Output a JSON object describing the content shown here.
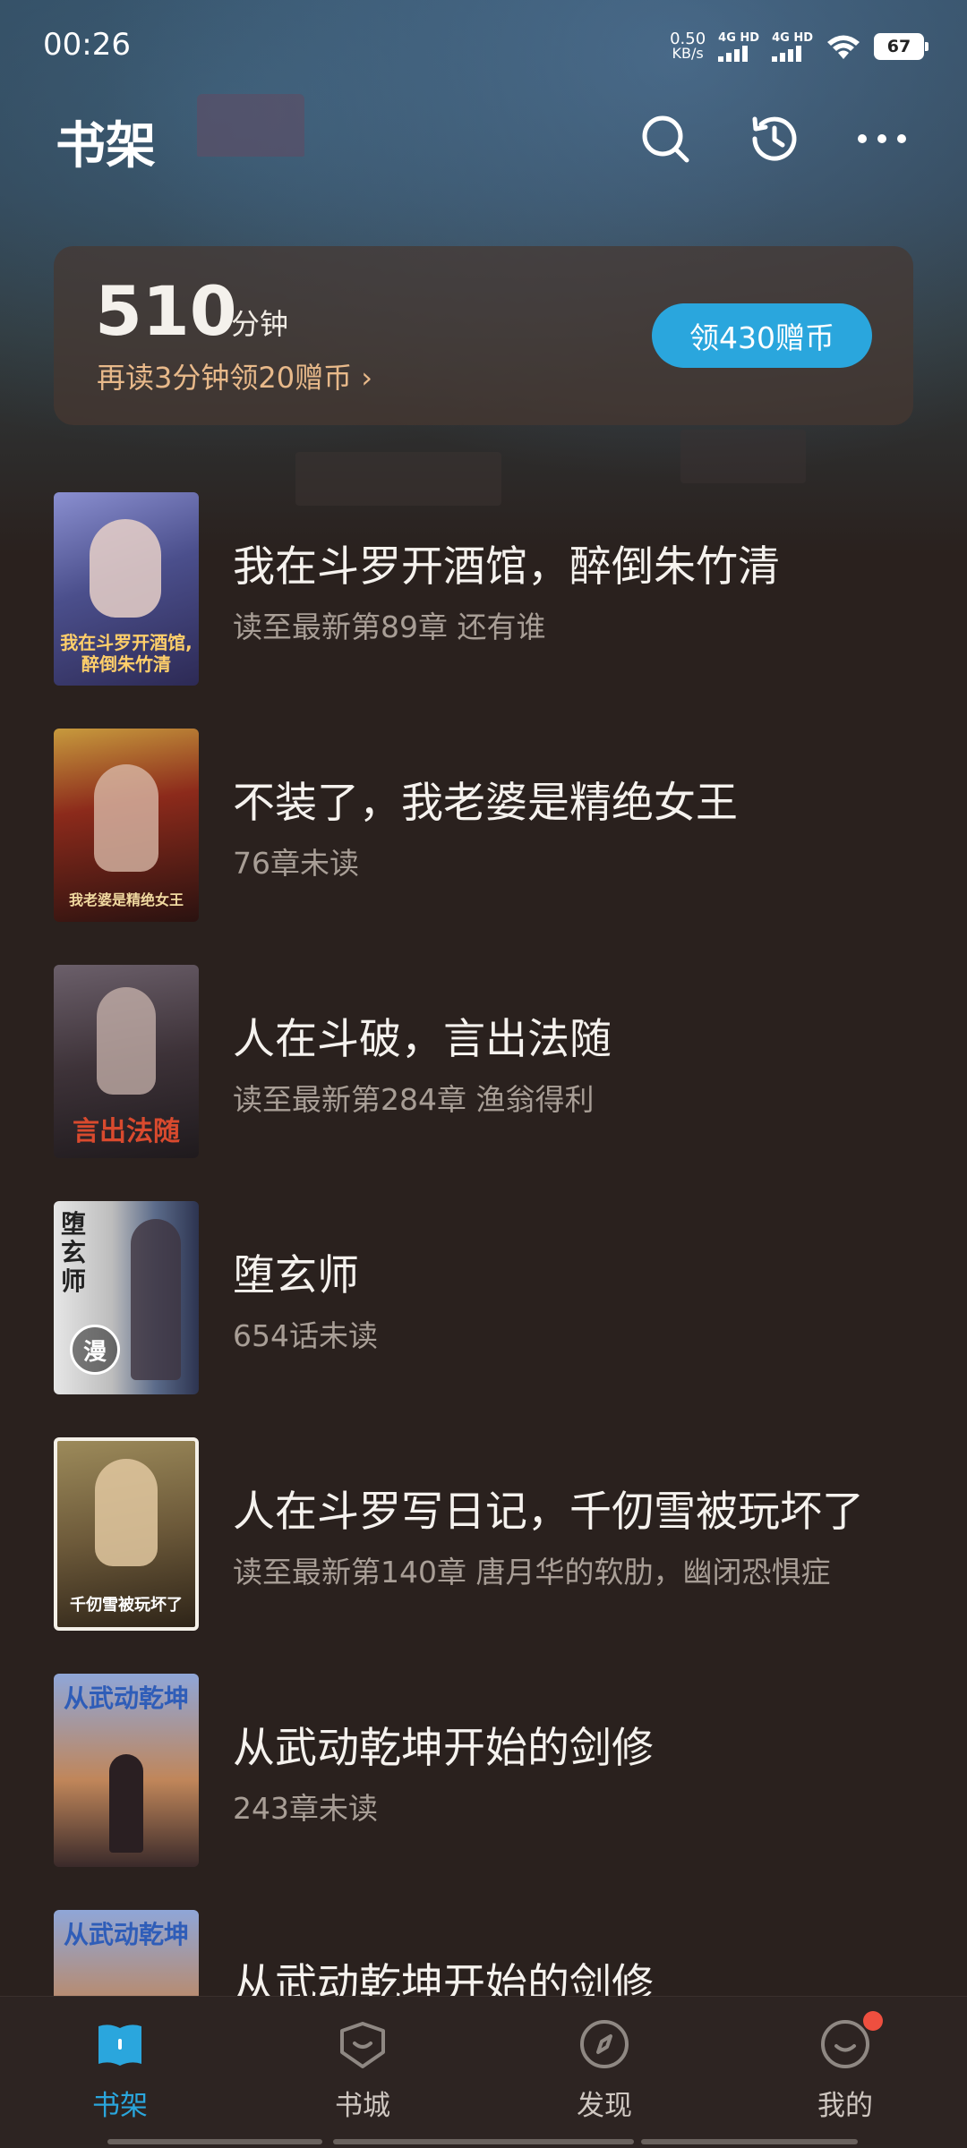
{
  "status_bar": {
    "time": "00:26",
    "net_speed_value": "0.50",
    "net_speed_unit": "KB/s",
    "sim1_label": "4G HD",
    "sim2_label": "4G HD",
    "battery": "67"
  },
  "header": {
    "title": "书架",
    "icons": [
      "search-icon",
      "history-icon",
      "more-icon"
    ]
  },
  "reading_card": {
    "minutes": "510",
    "unit": "分钟",
    "hint": "再读3分钟领20赠币 ›",
    "button_label": "领430赠币"
  },
  "books": [
    {
      "title": "我在斗罗开酒馆，醉倒朱竹清",
      "subtitle": "读至最新第89章 还有谁",
      "cover_text": "我在斗罗开酒馆,醉倒朱竹清",
      "cover_color": "#5a5f9c"
    },
    {
      "title": "不装了，我老婆是精绝女王",
      "subtitle": "76章未读",
      "cover_text": "我老婆是精绝女王",
      "cover_color": "#7a2a1e"
    },
    {
      "title": "人在斗破，言出法随",
      "subtitle": "读至最新第284章 渔翁得利",
      "cover_text": "言出法随",
      "cover_color": "#4b3e40"
    },
    {
      "title": "堕玄师",
      "subtitle": "654话未读",
      "cover_text": "堕玄师",
      "cover_color": "#b8b8b8",
      "badge": "漫"
    },
    {
      "title": "人在斗罗写日记，千仞雪被玩坏了",
      "subtitle": "读至最新第140章 唐月华的软肋，幽闭恐惧症",
      "cover_text": "千仞雪被玩坏了",
      "cover_color": "#8a7046"
    },
    {
      "title": "从武动乾坤开始的剑修",
      "subtitle": "243章未读",
      "cover_text": "从武动乾坤",
      "cover_color": "#6a7aa8"
    },
    {
      "title": "从武动乾坤开始的剑修",
      "subtitle": "",
      "cover_text": "从武动乾坤",
      "cover_color": "#6a7aa8"
    }
  ],
  "bottom_nav": [
    {
      "label": "书架",
      "icon": "bookshelf-icon",
      "active": true
    },
    {
      "label": "书城",
      "icon": "bookstore-icon",
      "active": false
    },
    {
      "label": "发现",
      "icon": "discover-icon",
      "active": false
    },
    {
      "label": "我的",
      "icon": "profile-icon",
      "active": false,
      "badge_dot": true
    }
  ],
  "colors": {
    "accent": "#2aa6dd",
    "hint_orange": "#e8b98a",
    "badge_red": "#ee4f3f"
  }
}
